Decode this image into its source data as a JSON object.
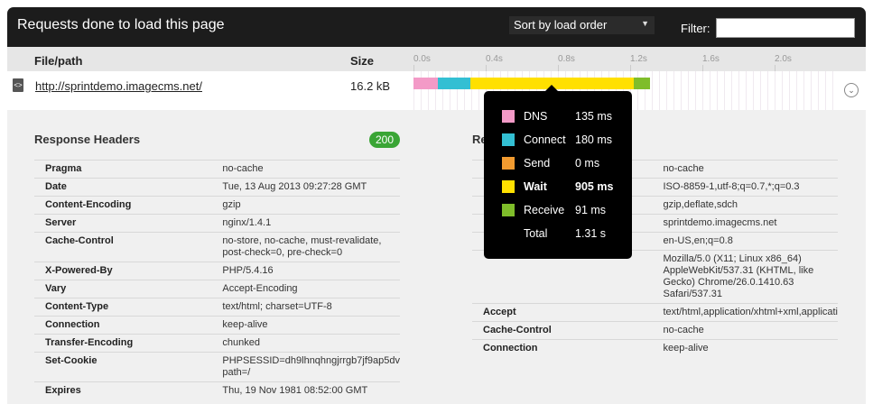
{
  "header": {
    "title": "Requests done to load this page",
    "sort_label": "Sort by load order",
    "filter_label": "Filter:",
    "filter_value": ""
  },
  "columns": {
    "file": "File/path",
    "size": "Size",
    "ticks": [
      "0.0s",
      "0.4s",
      "0.8s",
      "1.2s",
      "1.6s",
      "2.0s"
    ]
  },
  "request": {
    "url": "http://sprintdemo.imagecms.net/",
    "size": "16.2 kB"
  },
  "timing": [
    {
      "name": "DNS",
      "value": "135 ms",
      "ms": 135,
      "color": "#f39ac7"
    },
    {
      "name": "Connect",
      "value": "180 ms",
      "ms": 180,
      "color": "#33bfd3"
    },
    {
      "name": "Send",
      "value": "0 ms",
      "ms": 0,
      "color": "#f29b30"
    },
    {
      "name": "Wait",
      "value": "905 ms",
      "ms": 905,
      "color": "#ffe000"
    },
    {
      "name": "Receive",
      "value": "91 ms",
      "ms": 91,
      "color": "#7fbd2a"
    }
  ],
  "timing_total": {
    "name": "Total",
    "value": "1.31 s"
  },
  "response_headers": {
    "title": "Response Headers",
    "status": "200",
    "rows": [
      {
        "key": "Pragma",
        "value": "no-cache"
      },
      {
        "key": "Date",
        "value": "Tue, 13 Aug 2013 09:27:28 GMT"
      },
      {
        "key": "Content-Encoding",
        "value": "gzip"
      },
      {
        "key": "Server",
        "value": "nginx/1.4.1"
      },
      {
        "key": "Cache-Control",
        "value": "no-store, no-cache, must-revalidate,\npost-check=0, pre-check=0"
      },
      {
        "key": "X-Powered-By",
        "value": "PHP/5.4.16"
      },
      {
        "key": "Vary",
        "value": "Accept-Encoding"
      },
      {
        "key": "Content-Type",
        "value": "text/html; charset=UTF-8"
      },
      {
        "key": "Connection",
        "value": "keep-alive"
      },
      {
        "key": "Transfer-Encoding",
        "value": "chunked"
      },
      {
        "key": "Set-Cookie",
        "value": "PHPSESSID=dh9lhnqhngjrrgb7jf9ap5dv\npath=/"
      },
      {
        "key": "Expires",
        "value": "Thu, 19 Nov 1981 08:52:00 GMT"
      }
    ]
  },
  "request_headers": {
    "title": "Re",
    "rows": [
      {
        "key": "",
        "value": "no-cache"
      },
      {
        "key": "",
        "value": "ISO-8859-1,utf-8;q=0.7,*;q=0.3"
      },
      {
        "key": "",
        "value": "gzip,deflate,sdch"
      },
      {
        "key": "",
        "value": "sprintdemo.imagecms.net"
      },
      {
        "key": "",
        "value": "en-US,en;q=0.8"
      },
      {
        "key": "",
        "value": "Mozilla/5.0 (X11; Linux x86_64)\nAppleWebKit/537.31 (KHTML, like\nGecko) Chrome/26.0.1410.63\nSafari/537.31"
      },
      {
        "key": "Accept",
        "value": "text/html,application/xhtml+xml,applicati"
      },
      {
        "key": "Cache-Control",
        "value": "no-cache"
      },
      {
        "key": "Connection",
        "value": "keep-alive"
      }
    ]
  }
}
